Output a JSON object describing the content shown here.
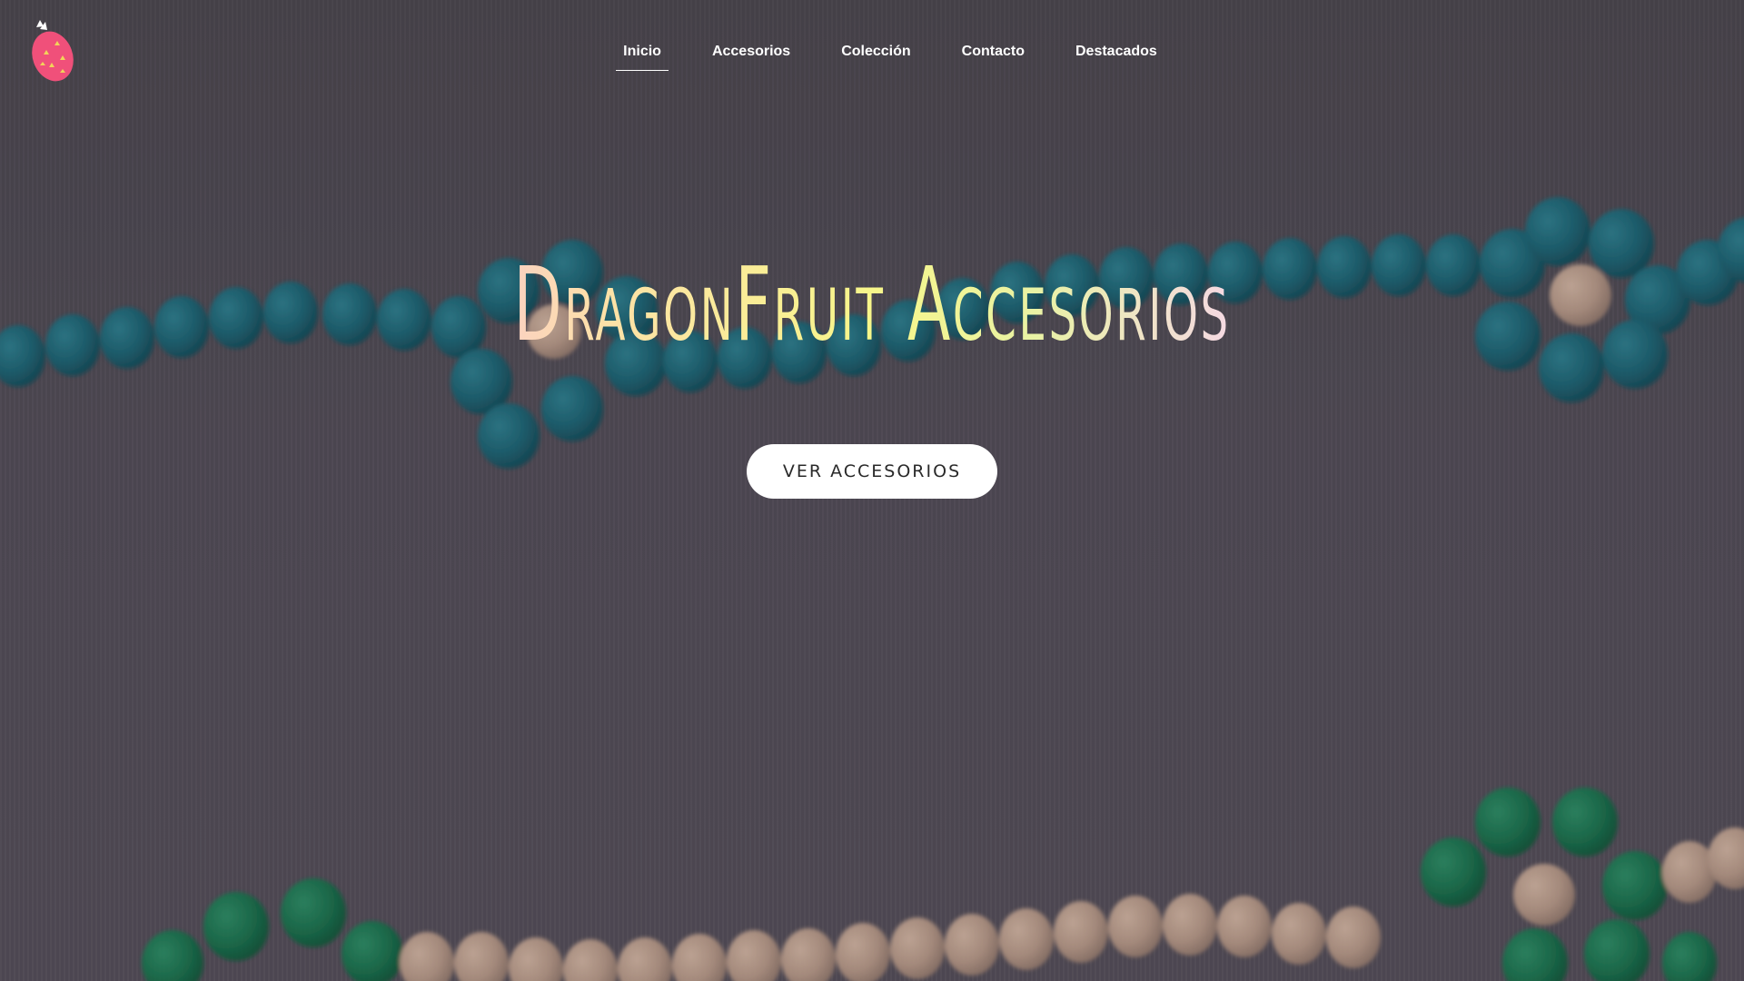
{
  "site": {
    "logo_icon": "dragonfruit-icon",
    "brand_colors": {
      "logo_pink": "#f0507a",
      "logo_seed": "#f2d35a",
      "nav_text": "#ffffff",
      "title_gradient": [
        "#f5b5f0",
        "#fde1a8",
        "#f7f68a",
        "#e9f2a4",
        "#f6d6e9",
        "#f2a8f0"
      ]
    }
  },
  "nav": {
    "items": [
      {
        "label": "Inicio",
        "active": true
      },
      {
        "label": "Accesorios",
        "active": false
      },
      {
        "label": "Colección",
        "active": false
      },
      {
        "label": "Contacto",
        "active": false
      },
      {
        "label": "Destacados",
        "active": false
      }
    ]
  },
  "hero": {
    "title": "DragonFruit Accesorios",
    "cta_label": "VER ACCESORIOS"
  }
}
